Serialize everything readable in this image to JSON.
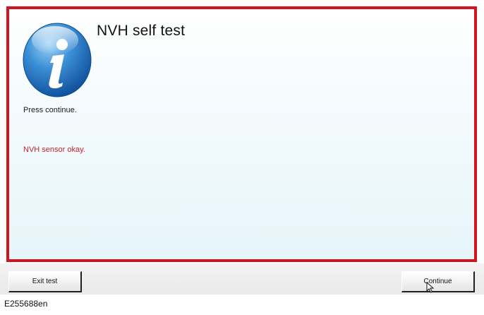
{
  "dialog": {
    "title": "NVH self test",
    "icon": "info-icon",
    "instruction": "Press continue.",
    "status": "NVH sensor okay."
  },
  "buttons": {
    "exit_label": "Exit test",
    "continue_label": "Continue"
  },
  "figure_ref": "E255688en",
  "colors": {
    "frame": "#d4141c",
    "status_text": "#c8202a",
    "icon_blue": "#1f6fb8"
  }
}
